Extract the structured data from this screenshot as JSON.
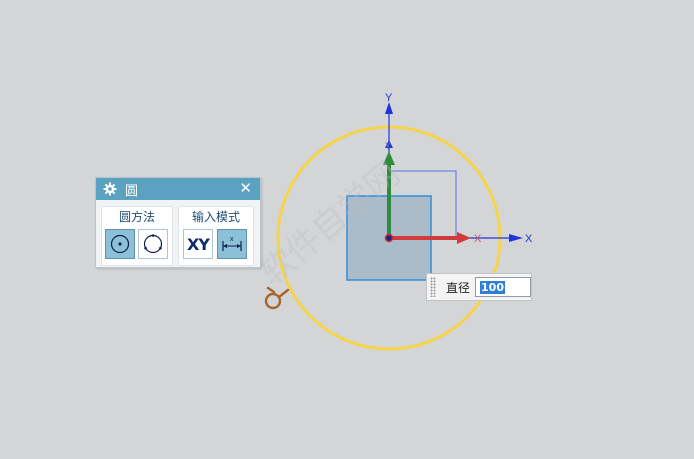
{
  "dialog": {
    "title": "圆",
    "close_label": "✕",
    "method_group": {
      "label": "圆方法"
    },
    "mode_group": {
      "label": "输入模式",
      "xy_label": "XY",
      "param_marker": "x"
    }
  },
  "axes": {
    "x_label": "X",
    "y_label": "Y"
  },
  "diameter": {
    "label": "直径",
    "value": "100"
  },
  "watermark": "软件自学网",
  "colors": {
    "background": "#d4d5d7",
    "circle": "#f5d44b",
    "x_axis": "#d23b3b",
    "y_axis": "#2f8c3e",
    "wcs_axis": "#1f35d8",
    "square_fill": "#a5b6c5",
    "square_border": "#2f8fdc",
    "dialog_title": "#5aa2bf"
  }
}
